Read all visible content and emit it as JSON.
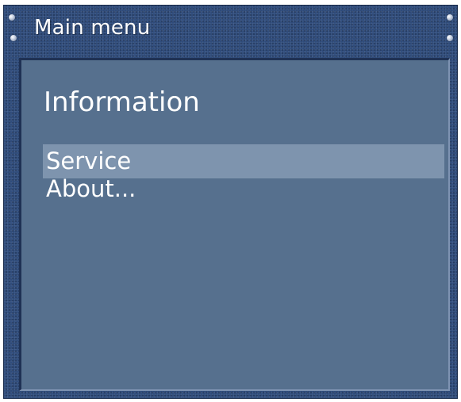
{
  "window": {
    "title": "Main menu"
  },
  "content": {
    "heading": "Information",
    "menu": {
      "selected_index": 0,
      "items": [
        {
          "label": "Service"
        },
        {
          "label": "About..."
        }
      ]
    }
  },
  "colors": {
    "frame": "#2b4878",
    "panel": "#56708e",
    "selection": "#7e94ae",
    "text": "#ffffff"
  }
}
